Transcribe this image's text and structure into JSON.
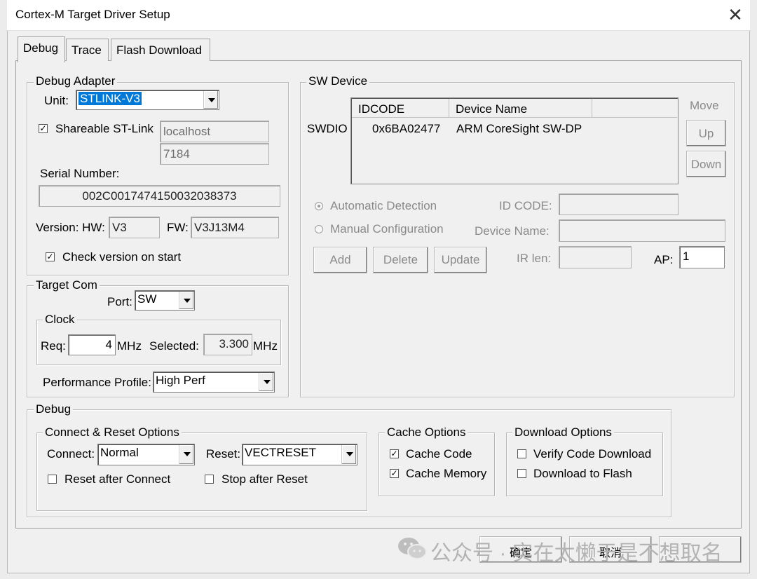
{
  "window": {
    "title": "Cortex-M Target Driver Setup",
    "close_glyph": "✕"
  },
  "tabs": [
    {
      "label": "Debug"
    },
    {
      "label": "Trace"
    },
    {
      "label": "Flash Download"
    }
  ],
  "debug_adapter": {
    "group_label": "Debug Adapter",
    "unit_label": "Unit:",
    "unit_value": "STLINK-V3",
    "shareable_label": "Shareable ST-Link",
    "shareable_checked": true,
    "host": "localhost",
    "port": "7184",
    "serial_label": "Serial Number:",
    "serial_value": "002C0017474150032038373",
    "version_hw_label": "Version: HW:",
    "version_hw_value": "V3",
    "fw_label": "FW:",
    "fw_value": "V3J13M4",
    "check_version_label": "Check version on start",
    "check_version_checked": true
  },
  "target_com": {
    "group_label": "Target Com",
    "port_label": "Port:",
    "port_value": "SW",
    "clock_label": "Clock",
    "req_label": "Req:",
    "req_value": "4",
    "mhz1": "MHz",
    "selected_label": "Selected:",
    "selected_value": "3.300",
    "mhz2": "MHz",
    "perf_label": "Performance Profile:",
    "perf_value": "High Perf"
  },
  "sw_device": {
    "group_label": "SW Device",
    "swdio_label": "SWDIO",
    "table_headers": [
      "IDCODE",
      "Device Name"
    ],
    "rows": [
      {
        "idcode": "0x6BA02477",
        "name": "ARM CoreSight SW-DP"
      }
    ],
    "move_label": "Move",
    "up_label": "Up",
    "down_label": "Down",
    "auto_detect_label": "Automatic Detection",
    "manual_config_label": "Manual Configuration",
    "id_code_label": "ID CODE:",
    "device_name_label": "Device Name:",
    "add_label": "Add",
    "delete_label": "Delete",
    "update_label": "Update",
    "ir_len_label": "IR len:",
    "ap_label": "AP:",
    "ap_value": "1"
  },
  "debug_section": {
    "group_label": "Debug",
    "connect_reset": {
      "group_label": "Connect & Reset Options",
      "connect_label": "Connect:",
      "connect_value": "Normal",
      "reset_label": "Reset:",
      "reset_value": "VECTRESET",
      "reset_after_connect": "Reset after Connect",
      "stop_after_reset": "Stop after Reset"
    },
    "cache": {
      "group_label": "Cache Options",
      "cache_code": "Cache Code",
      "cache_memory": "Cache Memory"
    },
    "download": {
      "group_label": "Download Options",
      "verify": "Verify Code Download",
      "download_flash": "Download to Flash"
    }
  },
  "footer": {
    "ok_label": "确定",
    "cancel_label": "取消",
    "watermark": "公众号 · 实在太懒于是不想取名"
  }
}
